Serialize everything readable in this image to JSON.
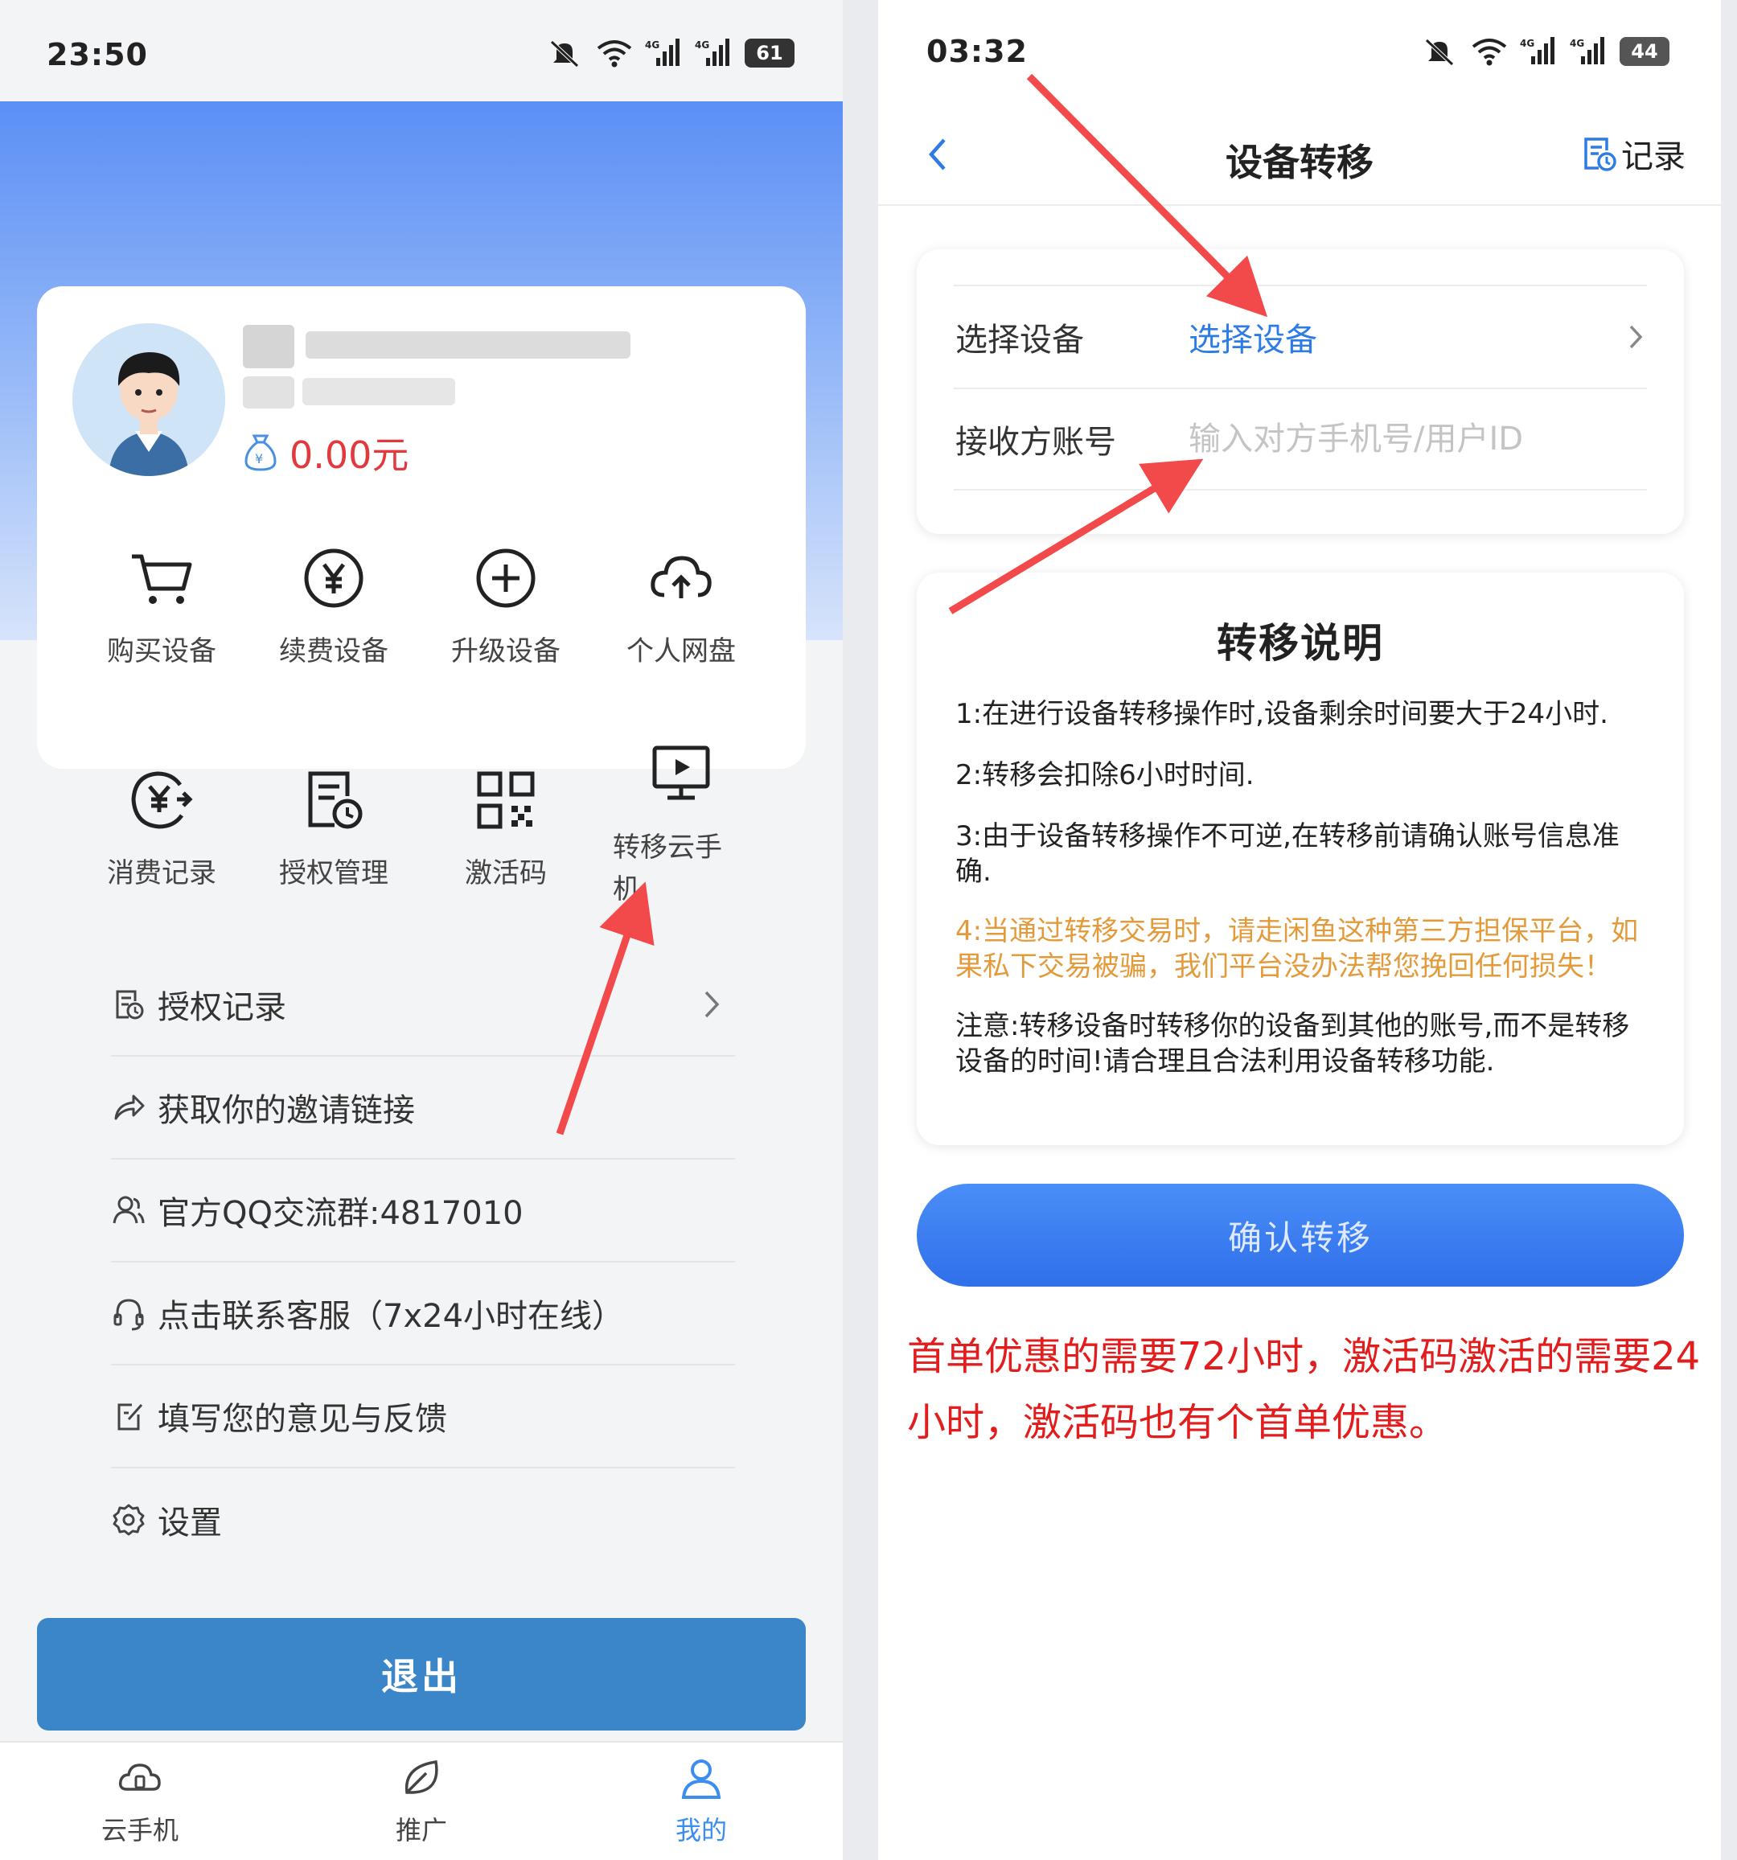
{
  "left": {
    "status": {
      "time": "23:50",
      "battery": "61"
    },
    "profile": {
      "balance": "0.00元"
    },
    "grid": [
      {
        "label": "购买设备",
        "icon": "shopping-cart-icon"
      },
      {
        "label": "续费设备",
        "icon": "yuan-circle-icon"
      },
      {
        "label": "升级设备",
        "icon": "plus-circle-icon"
      },
      {
        "label": "个人网盘",
        "icon": "cloud-upload-icon"
      },
      {
        "label": "消费记录",
        "icon": "yuan-arrow-icon"
      },
      {
        "label": "授权管理",
        "icon": "document-clock-icon"
      },
      {
        "label": "激活码",
        "icon": "qr-code-icon"
      },
      {
        "label": "转移云手\n机",
        "icon": "monitor-play-icon"
      }
    ],
    "menu": [
      {
        "label": "授权记录",
        "icon": "document-clock-icon"
      },
      {
        "label": "获取你的邀请链接",
        "icon": "share-arrow-icon"
      },
      {
        "label": "官方QQ交流群:4817010",
        "icon": "users-icon"
      },
      {
        "label": "点击联系客服（7x24小时在线）",
        "icon": "headset-icon"
      },
      {
        "label": "填写您的意见与反馈",
        "icon": "edit-note-icon"
      },
      {
        "label": "设置",
        "icon": "gear-icon"
      }
    ],
    "logout_label": "退出",
    "tabs": [
      {
        "label": "云手机",
        "icon": "cloud-phone-icon",
        "active": false
      },
      {
        "label": "推广",
        "icon": "leaf-icon",
        "active": false
      },
      {
        "label": "我的",
        "icon": "user-icon",
        "active": true
      }
    ]
  },
  "right": {
    "status": {
      "time": "03:32",
      "battery": "44"
    },
    "nav": {
      "title": "设备转移",
      "record_label": "记录"
    },
    "form": {
      "device_label": "选择设备",
      "device_value": "选择设备",
      "receiver_label": "接收方账号",
      "receiver_placeholder": "输入对方手机号/用户ID"
    },
    "instructions": {
      "title": "转移说明",
      "items": [
        "1:在进行设备转移操作时,设备剩余时间要大于24小时.",
        "2:转移会扣除6小时时间.",
        "3:由于设备转移操作不可逆,在转移前请确认账号信息准确.",
        "4:当通过转移交易时，请走闲鱼这种第三方担保平台，如果私下交易被骗，我们平台没办法帮您挽回任何损失！",
        "注意:转移设备时转移你的设备到其他的账号,而不是转移设备的时间!请合理且合法利用设备转移功能."
      ]
    },
    "confirm_label": "确认转移",
    "annotation": "首单优惠的需要72小时，激活码激活的需要24小时，激活码也有个首单优惠。"
  },
  "colors": {
    "accent_blue": "#2d7be5",
    "logout_blue": "#3b86c8",
    "balance_red": "#e2393f",
    "warning_orange": "#e39a3a",
    "annotation_red": "#e21d1d",
    "arrow_red": "#f24a4a"
  }
}
